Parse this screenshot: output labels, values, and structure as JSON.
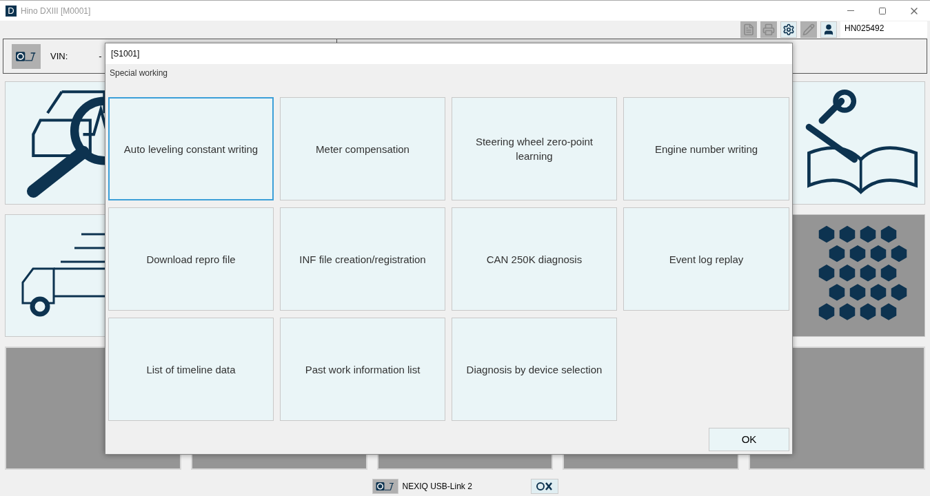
{
  "window": {
    "title": "Hino DXIII [M0001]",
    "app_letter": "D"
  },
  "toolbar": {
    "buttons": [
      {
        "kind": "document",
        "disabled": true
      },
      {
        "kind": "print",
        "disabled": true
      },
      {
        "kind": "settings",
        "disabled": false
      },
      {
        "kind": "edit",
        "disabled": true
      },
      {
        "kind": "user",
        "disabled": false
      }
    ],
    "user_id": "HN025492"
  },
  "vehicle_bar": {
    "vin_label": "VIN:",
    "vin_value": "-"
  },
  "dialog": {
    "code": "[S1001]",
    "subtitle": "Special working",
    "items": [
      {
        "label": "Auto leveling constant writing",
        "selected": true
      },
      {
        "label": "Meter compensation",
        "selected": false
      },
      {
        "label": "Steering wheel zero-point learning",
        "selected": false
      },
      {
        "label": "Engine number writing",
        "selected": false
      },
      {
        "label": "Download repro file",
        "selected": false
      },
      {
        "label": "INF file creation/registration",
        "selected": false
      },
      {
        "label": "CAN 250K diagnosis",
        "selected": false
      },
      {
        "label": "Event log replay",
        "selected": false
      },
      {
        "label": "List of timeline data",
        "selected": false
      },
      {
        "label": "Past work information list",
        "selected": false
      },
      {
        "label": "Diagnosis by device selection",
        "selected": false
      }
    ],
    "ok_button": "OK"
  },
  "status_bar": {
    "device": "NEXIQ USB-Link 2"
  }
}
